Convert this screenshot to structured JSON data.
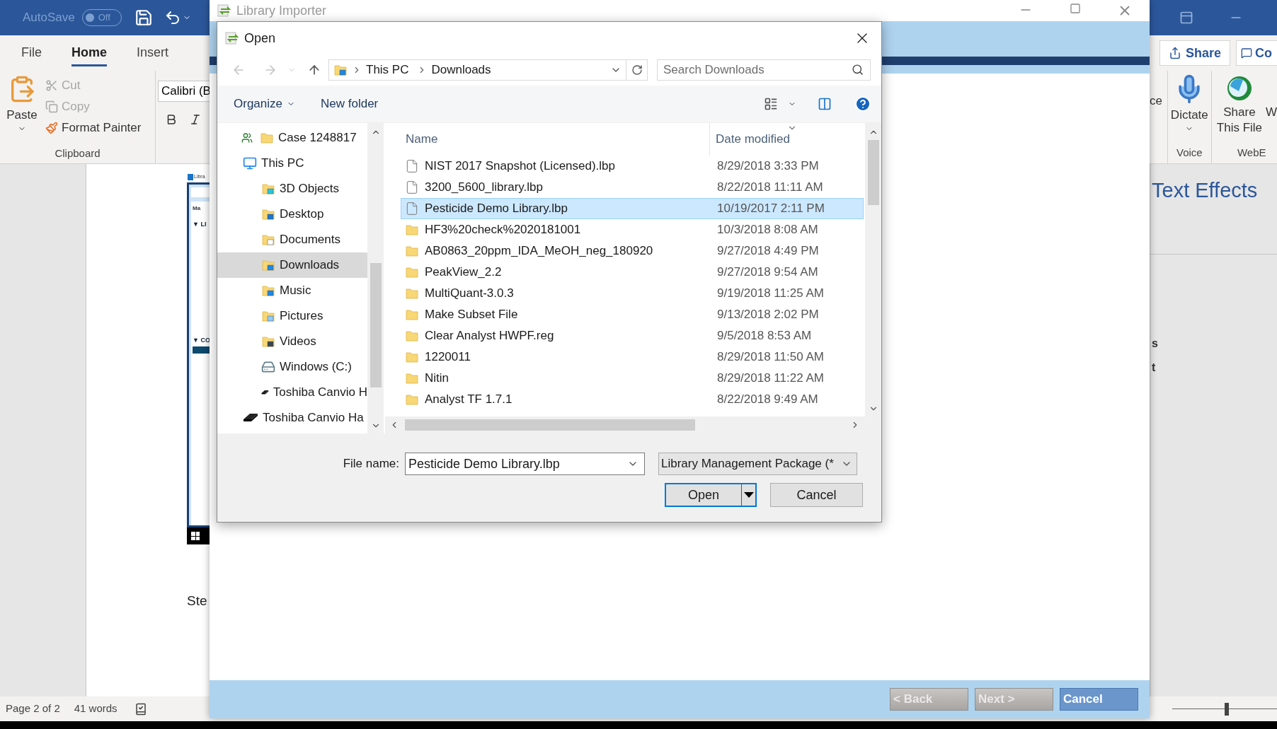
{
  "word": {
    "autosave": {
      "label": "AutoSave",
      "toggle": "Off",
      "on": false
    },
    "tabs": [
      {
        "label": "File",
        "selected": false
      },
      {
        "label": "Home",
        "selected": true
      },
      {
        "label": "Insert",
        "selected": false
      }
    ],
    "share_button": "Share",
    "comments_button": "Co",
    "clipboard": {
      "paste": "Paste",
      "group": "Clipboard",
      "items": [
        {
          "kind": "cut",
          "label": "Cut",
          "disabled": true
        },
        {
          "kind": "copy",
          "label": "Copy",
          "disabled": true
        },
        {
          "kind": "painter",
          "label": "Format Painter",
          "disabled": false
        }
      ]
    },
    "font_box": "Calibri (B",
    "ribbon_right": {
      "partial_label": "ce",
      "dictate": "Dictate",
      "voice_group": "Voice",
      "share_this_file": "Share This File",
      "partial_button": "W",
      "webex_group": "WebE"
    },
    "document": {
      "embedded_screenshot": {
        "title": "Libra",
        "tab": "Ma",
        "sections": [
          "▼ LI",
          "▼ CO"
        ]
      },
      "text": "Ste"
    },
    "pane": {
      "heading": "Text Effects",
      "fragments": [
        "s",
        "t"
      ]
    },
    "status_bar": {
      "page": "Page 2 of 2",
      "words": "41 words",
      "zoom": {
        "level": 0.5
      }
    }
  },
  "importer": {
    "title": "Library Importer",
    "buttons": [
      {
        "label": "< Back",
        "disabled": true
      },
      {
        "label": "Next >",
        "disabled": true
      },
      {
        "label": "Cancel",
        "disabled": false
      }
    ]
  },
  "dialog": {
    "title": "Open",
    "breadcrumb": [
      "This PC",
      "Downloads"
    ],
    "search": {
      "placeholder": "Search Downloads"
    },
    "toolbar": [
      "Organize",
      "New folder"
    ],
    "nav": [
      {
        "label": "Case 1248817",
        "kind": "group",
        "selected": false
      },
      {
        "label": "This PC",
        "kind": "pc",
        "selected": false,
        "children": [
          {
            "label": "3D Objects",
            "kind": "objects",
            "selected": false
          },
          {
            "label": "Desktop",
            "kind": "desktop",
            "selected": false
          },
          {
            "label": "Documents",
            "kind": "documents",
            "selected": false
          },
          {
            "label": "Downloads",
            "kind": "downloads",
            "selected": true
          },
          {
            "label": "Music",
            "kind": "music",
            "selected": false
          },
          {
            "label": "Pictures",
            "kind": "pictures",
            "selected": false
          },
          {
            "label": "Videos",
            "kind": "videos",
            "selected": false
          },
          {
            "label": "Windows (C:)",
            "kind": "drive",
            "selected": false
          },
          {
            "label": "Toshiba Canvio H",
            "kind": "external",
            "selected": false
          }
        ]
      },
      {
        "label": "Toshiba Canvio Ha",
        "kind": "external",
        "selected": false
      }
    ],
    "columns": [
      "Name",
      "Date modified"
    ],
    "files": [
      {
        "name": "NIST 2017 Snapshot (Licensed).lbp",
        "date": "8/29/2018 3:33 PM",
        "kind": "file",
        "selected": false
      },
      {
        "name": "3200_5600_library.lbp",
        "date": "8/22/2018 11:11 AM",
        "kind": "file",
        "selected": false
      },
      {
        "name": "Pesticide Demo Library.lbp",
        "date": "10/19/2017 2:11 PM",
        "kind": "file",
        "selected": true
      },
      {
        "name": "HF3%20check%2020181001",
        "date": "10/3/2018 8:08 AM",
        "kind": "folder",
        "selected": false
      },
      {
        "name": "AB0863_20ppm_IDA_MeOH_neg_180920",
        "date": "9/27/2018 4:49 PM",
        "kind": "folder",
        "selected": false
      },
      {
        "name": "PeakView_2.2",
        "date": "9/27/2018 9:54 AM",
        "kind": "folder",
        "selected": false
      },
      {
        "name": "MultiQuant-3.0.3",
        "date": "9/19/2018 11:25 AM",
        "kind": "folder",
        "selected": false
      },
      {
        "name": "Make Subset File",
        "date": "9/13/2018 2:02 PM",
        "kind": "folder",
        "selected": false
      },
      {
        "name": "Clear Analyst HWPF.reg",
        "date": "9/5/2018 8:53 AM",
        "kind": "folder",
        "selected": false
      },
      {
        "name": "1220011",
        "date": "8/29/2018 11:50 AM",
        "kind": "folder",
        "selected": false
      },
      {
        "name": "Nitin",
        "date": "8/29/2018 11:22 AM",
        "kind": "folder",
        "selected": false
      },
      {
        "name": "Analyst TF 1.7.1",
        "date": "8/22/2018 9:49 AM",
        "kind": "folder",
        "selected": false
      }
    ],
    "file_name_label": "File name:",
    "file_name": "Pesticide Demo Library.lbp",
    "file_type": "Library Management Package (*",
    "open_button": "Open",
    "cancel_button": "Cancel"
  }
}
